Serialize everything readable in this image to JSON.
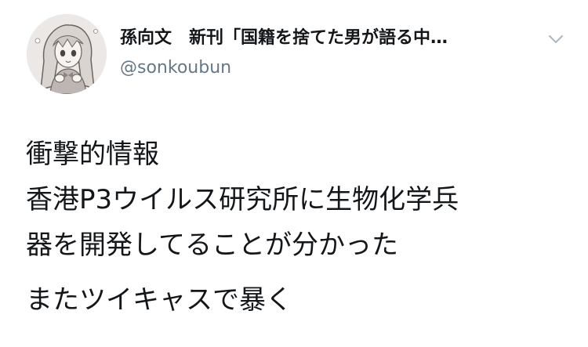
{
  "author": {
    "display_name": "孫向文　新刊「国籍を捨てた男が語る中…",
    "handle": "@sonkoubun",
    "avatar_icon": "manga-girl-avatar-icon"
  },
  "menu": {
    "icon": "chevron-down-icon"
  },
  "tweet": {
    "lines": [
      "衝撃的情報",
      "香港P3ウイルス研究所に生物化学兵",
      "器を開発してることが分かった"
    ],
    "extra_line": "またツイキャスで暴く"
  },
  "colors": {
    "text": "#14171a",
    "secondary": "#657786",
    "chevron": "#aab8c2",
    "background": "#ffffff"
  }
}
